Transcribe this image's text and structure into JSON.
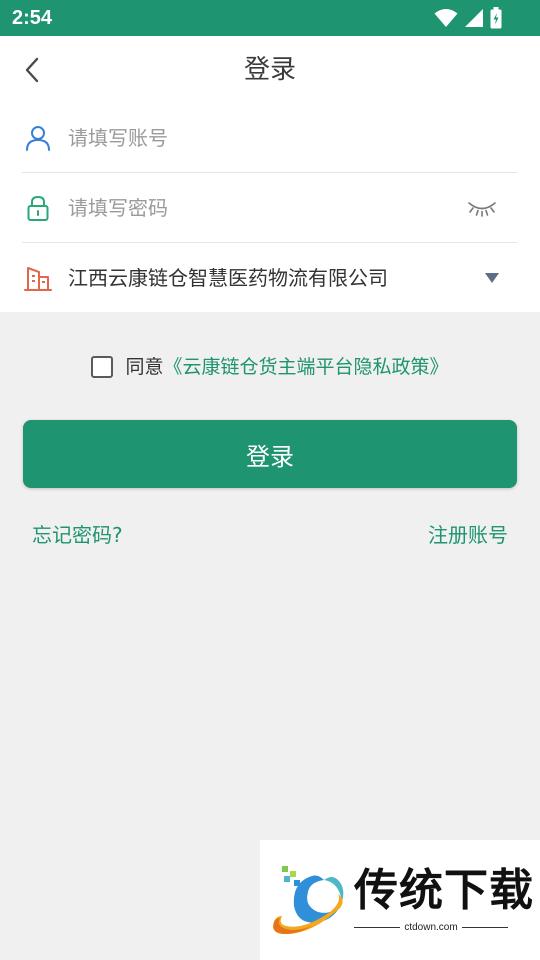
{
  "status_bar": {
    "time": "2:54",
    "background": "#1e9470"
  },
  "header": {
    "title": "登录"
  },
  "form": {
    "account": {
      "placeholder": "请填写账号",
      "value": ""
    },
    "password": {
      "placeholder": "请填写密码",
      "value": ""
    },
    "company": {
      "value": "江西云康链仓智慧医药物流有限公司"
    }
  },
  "agreement": {
    "checked": false,
    "prefix": "同意",
    "policy": "《云康链仓货主端平台隐私政策》"
  },
  "actions": {
    "login_label": "登录",
    "forgot_label": "忘记密码?",
    "register_label": "注册账号"
  },
  "watermark": {
    "title": "传统下载",
    "url": "ctdown.com"
  },
  "colors": {
    "accent": "#1e9470",
    "user_icon": "#3a7fd5",
    "lock_icon": "#2aa876",
    "building_icon": "#e2674a"
  },
  "icons": {
    "back": "chevron-left-icon",
    "account": "user-icon",
    "password": "lock-icon",
    "eye": "eye-closed-icon",
    "company": "building-icon",
    "dropdown": "caret-down-icon"
  }
}
